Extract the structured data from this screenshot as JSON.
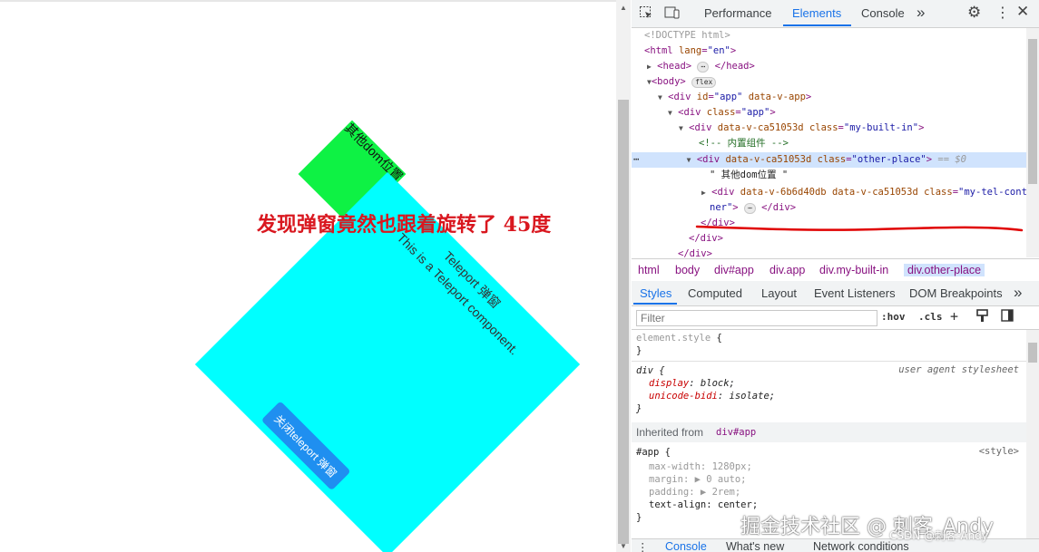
{
  "preview": {
    "green_box_text": "其他dom位置",
    "annotation": "发现弹窗竟然也跟着旋转了 45度",
    "cyan_box": {
      "title": "Teleport 弹窗",
      "body": "This is a Teleport component.",
      "close_button": "关闭teleport 弹窗"
    },
    "colors": {
      "green": "#0ef244",
      "cyan": "#00ffff",
      "annotation": "#d9171f",
      "button": "#1f8ff0"
    }
  },
  "devtools": {
    "main_tabs": [
      "Performance",
      "Elements",
      "Console"
    ],
    "active_tab": "Elements",
    "more_tabs": "»",
    "icons": [
      "inspect-icon",
      "device-toolbar-icon",
      "settings-icon",
      "kebab-menu-icon",
      "close-icon"
    ],
    "tree": {
      "doctype": "<!DOCTYPE html>",
      "html_open": "<html",
      "html_lang_attr": "lang",
      "html_lang_val": "\"en\"",
      "html_close": ">",
      "head_open": "<head>",
      "head_ellipsis": "⋯",
      "head_close": "</head>",
      "body_open": "<body>",
      "body_badge": "flex",
      "div_app_open": "<div",
      "div_app_attr": "id",
      "div_app_val": "\"app\"",
      "div_app_attr2": "data-v-app",
      "div_app_close": ">",
      "div_class_app_open": "<div",
      "div_class_app_attr": "class",
      "div_class_app_val": "\"app\"",
      "div_class_app_close": ">",
      "builtin_open": "<div",
      "builtin_attr1": "data-v-ca51053d",
      "builtin_attr2": "class",
      "builtin_val": "\"my-built-in\"",
      "builtin_close": ">",
      "comment": "<!-- 内置组件 -->",
      "other_open": "<div",
      "other_attr1": "data-v-ca51053d",
      "other_attr2": "class",
      "other_val": "\"other-place\"",
      "other_close": ">",
      "other_marker": "== $0",
      "text_node": "\" 其他dom位置 \"",
      "tel_open": "<div",
      "tel_attr1": "data-v-6b6d40db",
      "tel_attr2": "data-v-ca51053d",
      "tel_attr3": "class",
      "tel_val": "\"my-tel-contai",
      "tel_wrap": "ner\"",
      "tel_close1": ">",
      "tel_ellipsis": "⋯",
      "tel_close2": "</div>",
      "close_div": "</div>",
      "dots": "⋯"
    },
    "breadcrumbs": [
      "html",
      "body",
      "div#app",
      "div.app",
      "div.my-built-in",
      "div.other-place"
    ],
    "active_breadcrumb": "div.other-place",
    "styles_tabs": [
      "Styles",
      "Computed",
      "Layout",
      "Event Listeners",
      "DOM Breakpoints"
    ],
    "active_styles_tab": "Styles",
    "filter_placeholder": "Filter",
    "filter_tools": [
      ":hov",
      ".cls",
      "+"
    ],
    "rules": {
      "element_style_selector": "element.style",
      "brace_open": "{",
      "brace_close": "}",
      "div_selector": "div",
      "div_source": "user agent stylesheet",
      "div_props": [
        {
          "name": "display",
          "value": "block"
        },
        {
          "name": "unicode-bidi",
          "value": "isolate"
        }
      ],
      "inherited_label": "Inherited from",
      "inherited_from": "div#app",
      "app_selector": "#app",
      "app_source": "<style>",
      "app_props": [
        {
          "name": "max-width",
          "value": "1280px",
          "muted": true
        },
        {
          "name": "margin",
          "value": "▶ 0 auto",
          "muted": true
        },
        {
          "name": "padding",
          "value": "▶ 2rem",
          "muted": true
        },
        {
          "name": "text-align",
          "value": "center",
          "muted": false
        }
      ]
    },
    "drawer_tabs": [
      "Console",
      "What's new",
      "Network conditions"
    ],
    "active_drawer_tab": "Console"
  },
  "watermark": {
    "primary": "掘金技术社区 @ 刺客_Andy",
    "secondary": "CSDN @刺客-Andy"
  }
}
